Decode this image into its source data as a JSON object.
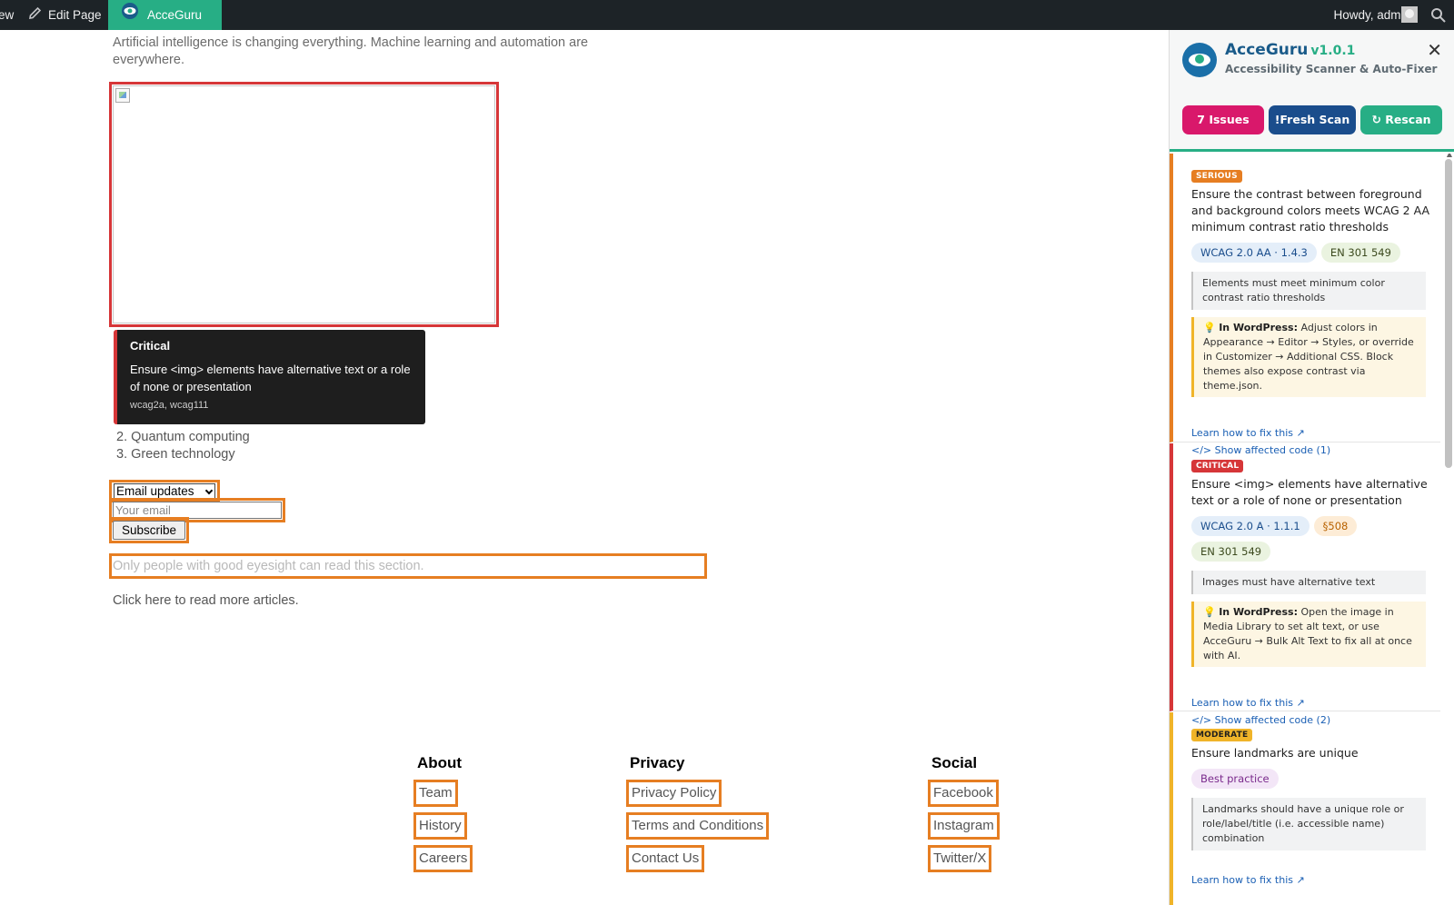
{
  "adminbar": {
    "view_label": "ew",
    "edit_label": "Edit Page",
    "plugin_label": "AcceGuru",
    "howdy_label": "Howdy, admin"
  },
  "page": {
    "intro": "Artificial intelligence is changing everything. Machine learning and automation are everywhere.",
    "tooltip": {
      "title": "Critical",
      "desc": "Ensure <img> elements have alternative text or a role of none or presentation",
      "tags": "wcag2a, wcag111"
    },
    "list_items": [
      "2. Quantum computing",
      "3. Green technology"
    ],
    "select_value": "Email updates",
    "email_placeholder": "Your email",
    "subscribe_label": "Subscribe",
    "eyesight_text": "Only people with good eyesight can read this section.",
    "click_here_text": "Click here to read more articles."
  },
  "footer": {
    "about": {
      "heading": "About",
      "links": [
        "Team",
        "History",
        "Careers"
      ]
    },
    "privacy": {
      "heading": "Privacy",
      "links": [
        "Privacy Policy",
        "Terms and Conditions",
        "Contact Us"
      ]
    },
    "social": {
      "heading": "Social",
      "links": [
        "Facebook",
        "Instagram",
        "Twitter/X"
      ]
    }
  },
  "panel": {
    "title": "AcceGuru",
    "version": "v1.0.1",
    "subtitle": "Accessibility Scanner & Auto-Fixer",
    "close": "✕",
    "btn_issues": "7 Issues",
    "btn_fresh": "!Fresh Scan",
    "btn_rescan": "↻ Rescan",
    "issues": [
      {
        "severity": "SERIOUS",
        "color": "#e67e22",
        "title": "Ensure the contrast between foreground and background colors meets WCAG 2 AA minimum contrast ratio thresholds",
        "tags": [
          "WCAG 2.0 AA · 1.4.3",
          "EN 301 549"
        ],
        "help": "Elements must meet minimum color contrast ratio thresholds",
        "wp_label": "In WordPress:",
        "wp_text": "Adjust colors in Appearance → Editor → Styles, or override in Customizer → Additional CSS. Block themes also expose contrast via theme.json.",
        "learn": "Learn how to fix this ↗",
        "show": "</> Show affected code (1)"
      },
      {
        "severity": "CRITICAL",
        "color": "#d63638",
        "title": "Ensure <img> elements have alternative text or a role of none or presentation",
        "tags": [
          "WCAG 2.0 A · 1.1.1",
          "§508",
          "EN 301 549"
        ],
        "help": "Images must have alternative text",
        "wp_label": "In WordPress:",
        "wp_text": "Open the image in Media Library to set alt text, or use AcceGuru → Bulk Alt Text to fix all at once with AI.",
        "learn": "Learn how to fix this ↗",
        "show": "</> Show affected code (2)"
      },
      {
        "severity": "MODERATE",
        "color": "#f0b429",
        "title": "Ensure landmarks are unique",
        "tags": [
          "Best practice"
        ],
        "help": "Landmarks should have a unique role or role/label/title (i.e. accessible name) combination",
        "learn": "Learn how to fix this ↗"
      }
    ]
  }
}
